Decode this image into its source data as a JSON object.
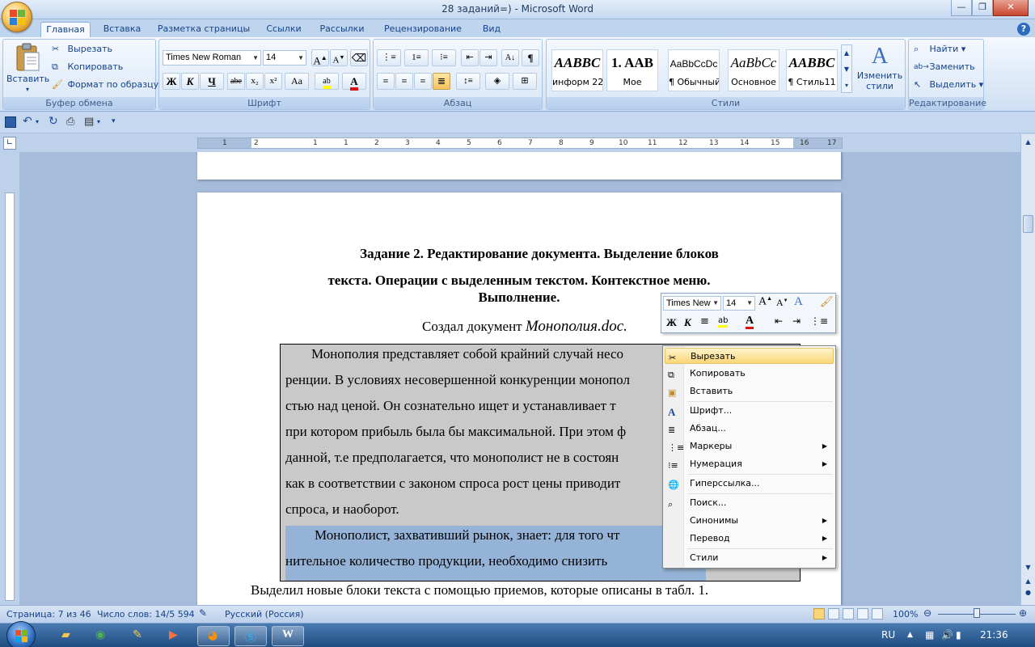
{
  "window": {
    "title": "28 заданий=) - Microsoft Word"
  },
  "tabs": [
    "Главная",
    "Вставка",
    "Разметка страницы",
    "Ссылки",
    "Рассылки",
    "Рецензирование",
    "Вид"
  ],
  "clipboard": {
    "paste": "Вставить",
    "cut": "Вырезать",
    "copy": "Копировать",
    "format_painter": "Формат по образцу",
    "label": "Буфер обмена"
  },
  "font": {
    "name": "Times New Roman",
    "size": "14",
    "label": "Шрифт",
    "bold": "Ж",
    "italic": "К",
    "underline": "Ч",
    "strike": "abe",
    "sub": "x₂",
    "sup": "x²",
    "case": "Aa"
  },
  "paragraph": {
    "label": "Абзац"
  },
  "styles": {
    "label": "Стили",
    "items": [
      {
        "sample": "AABBC",
        "name": "информ 22"
      },
      {
        "sample": "1. AAB",
        "name": "Мое"
      },
      {
        "sample": "AaBbCcDc",
        "name": "¶ Обычный"
      },
      {
        "sample": "AaBbCc",
        "name": "Основное"
      },
      {
        "sample": "AABBC",
        "name": "¶ Стиль11"
      }
    ],
    "change": "Изменить стили"
  },
  "editing": {
    "find": "Найти",
    "replace": "Заменить",
    "select": "Выделить",
    "label": "Редактирование"
  },
  "ruler": {
    "numbers": [
      "1",
      "2",
      "1",
      "1",
      "2",
      "3",
      "4",
      "5",
      "6",
      "7",
      "8",
      "9",
      "10",
      "11",
      "12",
      "13",
      "14",
      "15",
      "16",
      "17",
      "18",
      "19"
    ]
  },
  "document": {
    "heading1": "Задание 2. Редактирование документа. Выделение блоков",
    "heading2": "текста. Операции с выделенным текстом. Контекстное меню.",
    "heading3": "Выполнение.",
    "created": "Создал документ",
    "created_file": "Монополия.doc.",
    "lines": [
      "Монополия представляет собой крайний случай несо",
      "ренции. В условиях  несовершенной конкуренции монопол",
      "стью над ценой. Он сознательно ищет и устанавливает т",
      "при котором прибыль была бы максимальной. При этом ф",
      "данной, т.е предполагается, что монополист не в состоян",
      "как в соответствии с законом  спроса рост цены приводит",
      "спроса, и наоборот."
    ],
    "lines2": [
      "Монополист, захвативший рынок, знает: для того чт",
      "нительное количество  продукции, необходимо снизить"
    ],
    "footer_line": "Выделил новые блоки текста с помощью приемов, которые описаны в табл. 1."
  },
  "mini_toolbar": {
    "font": "Times New",
    "size": "14"
  },
  "context_menu": {
    "items": [
      {
        "label": "Вырезать",
        "icon": "scissors-icon",
        "sub": false
      },
      {
        "label": "Копировать",
        "icon": "copy-icon",
        "sub": false
      },
      {
        "label": "Вставить",
        "icon": "paste-icon",
        "sub": false
      },
      {
        "label": "Шрифт...",
        "icon": "font-icon",
        "sub": false
      },
      {
        "label": "Абзац...",
        "icon": "paragraph-icon",
        "sub": false
      },
      {
        "label": "Маркеры",
        "icon": "bullets-icon",
        "sub": true
      },
      {
        "label": "Нумерация",
        "icon": "numbering-icon",
        "sub": true
      },
      {
        "label": "Гиперссылка...",
        "icon": "hyperlink-icon",
        "sub": false
      },
      {
        "label": "Поиск...",
        "icon": "research-icon",
        "sub": false
      },
      {
        "label": "Синонимы",
        "icon": "",
        "sub": true
      },
      {
        "label": "Перевод",
        "icon": "",
        "sub": true
      },
      {
        "label": "Стили",
        "icon": "",
        "sub": true
      }
    ]
  },
  "status": {
    "page": "Страница: 7 из 46",
    "words": "Число слов: 14/5 594",
    "language": "Русский (Россия)",
    "zoom": "100%"
  },
  "taskbar": {
    "lang": "RU",
    "time": "21:36"
  },
  "colors": {
    "highlight": "#fad678",
    "selection": "#c9c9c9",
    "selection2": "#95b3d7",
    "ribbon": "#dde9f8"
  }
}
